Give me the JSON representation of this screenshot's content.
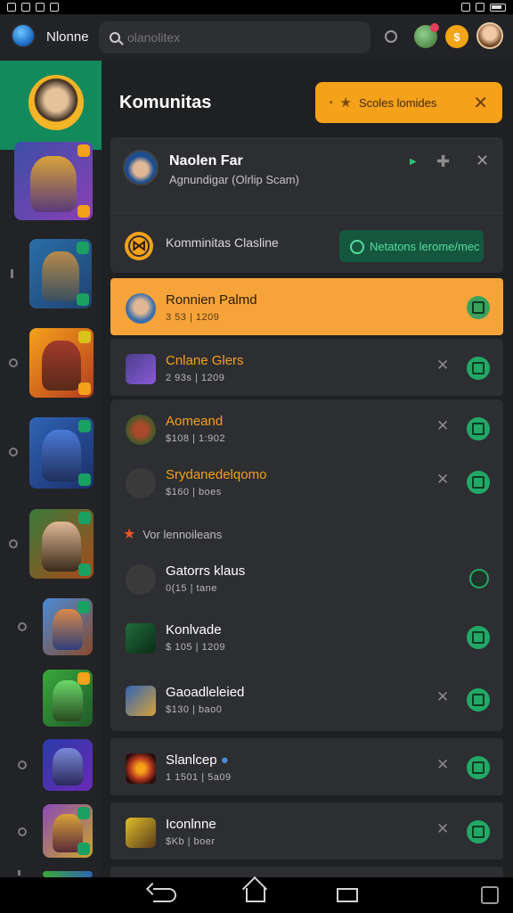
{
  "app": {
    "name": "Nlonne"
  },
  "search": {
    "placeholder": "olanolitex"
  },
  "page": {
    "title": "Komunitas"
  },
  "pill": {
    "label": "Scoles lomides"
  },
  "profile": {
    "name": "Naolen Far",
    "subtitle": "Agnundigar (Olrlip Scam)",
    "community_label": "Komminitas Clasline",
    "button_label": "Netatons lerome/mec"
  },
  "list": [
    {
      "name": "Ronnien Palmd",
      "sub": "3 53 | 1209",
      "active": true,
      "orange": false,
      "has_x": false,
      "thumb": "#3d6fa8"
    },
    {
      "name": "Cnlane Glers",
      "sub": "2 93s | 1209",
      "active": false,
      "orange": true,
      "has_x": true,
      "thumb": "#4a3f8c"
    },
    {
      "name": "Aomeand",
      "sub": "$108 | 1:902",
      "active": false,
      "orange": true,
      "has_x": true,
      "thumb": "#6b2a2a"
    },
    {
      "name": "Srydanedelqomo",
      "sub": "$160 | boes",
      "active": false,
      "orange": true,
      "has_x": true,
      "thumb": "#3a3a3a"
    }
  ],
  "section": {
    "label": "Vor lennoileans"
  },
  "list2": [
    {
      "name": "Gatorrs klaus",
      "sub": "0(15 | tane",
      "has_x": false,
      "thumb": "#3a3a3a"
    },
    {
      "name": "Konlvade",
      "sub": "$ 105 | 1209",
      "has_x": false,
      "thumb": "#1f6d3a"
    },
    {
      "name": "Gaoadleleied",
      "sub": "$130 | bao0",
      "has_x": true,
      "thumb": "#2f64b5"
    },
    {
      "name": "Slanlcep",
      "sub": "1 1501 | 5a09",
      "has_x": true,
      "thumb": "#b5381f"
    },
    {
      "name": "Iconlnne",
      "sub": "$Kb | boer",
      "has_x": true,
      "thumb": "#c9a52a"
    }
  ],
  "colors": {
    "accent": "#f5a11a",
    "green": "#22a866",
    "rail_active": "#138a5c"
  }
}
